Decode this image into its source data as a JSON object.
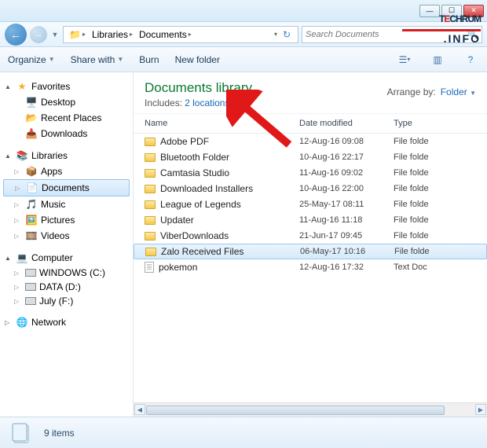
{
  "breadcrumb": {
    "lib": "Libraries",
    "cur": "Documents"
  },
  "search": {
    "placeholder": "Search Documents"
  },
  "toolbar": {
    "organize": "Organize",
    "share": "Share with",
    "burn": "Burn",
    "newfolder": "New folder"
  },
  "library": {
    "title": "Documents library",
    "includesLabel": "Includes:",
    "locations": "2 locations",
    "arrangeLabel": "Arrange by:",
    "arrangeValue": "Folder"
  },
  "columns": {
    "name": "Name",
    "date": "Date modified",
    "type": "Type"
  },
  "sidebar": {
    "favorites": "Favorites",
    "fav": [
      "Desktop",
      "Recent Places",
      "Downloads"
    ],
    "libraries": "Libraries",
    "libs": [
      "Apps",
      "Documents",
      "Music",
      "Pictures",
      "Videos"
    ],
    "computer": "Computer",
    "drives": [
      "WINDOWS (C:)",
      "DATA (D:)",
      "July (F:)"
    ],
    "network": "Network"
  },
  "rows": [
    {
      "name": "Adobe PDF",
      "date": "12-Aug-16 09:08",
      "type": "File folde",
      "icon": "folder"
    },
    {
      "name": "Bluetooth Folder",
      "date": "10-Aug-16 22:17",
      "type": "File folde",
      "icon": "folder"
    },
    {
      "name": "Camtasia Studio",
      "date": "11-Aug-16 09:02",
      "type": "File folde",
      "icon": "folder"
    },
    {
      "name": "Downloaded Installers",
      "date": "10-Aug-16 22:00",
      "type": "File folde",
      "icon": "folder"
    },
    {
      "name": "League of Legends",
      "date": "25-May-17 08:11",
      "type": "File folde",
      "icon": "folder"
    },
    {
      "name": "Updater",
      "date": "11-Aug-16 11:18",
      "type": "File folde",
      "icon": "folder"
    },
    {
      "name": "ViberDownloads",
      "date": "21-Jun-17 09:45",
      "type": "File folde",
      "icon": "folder"
    },
    {
      "name": "Zalo Received Files",
      "date": "06-May-17 10:16",
      "type": "File folde",
      "icon": "folder",
      "selected": true
    },
    {
      "name": "pokemon",
      "date": "12-Aug-16 17:32",
      "type": "Text Doc",
      "icon": "text"
    }
  ],
  "status": {
    "count": "9 items"
  },
  "watermark": {
    "brand_pre": "T",
    "brand_red": "E",
    "brand_post": "CHRUM",
    "suffix": ".INFO"
  }
}
